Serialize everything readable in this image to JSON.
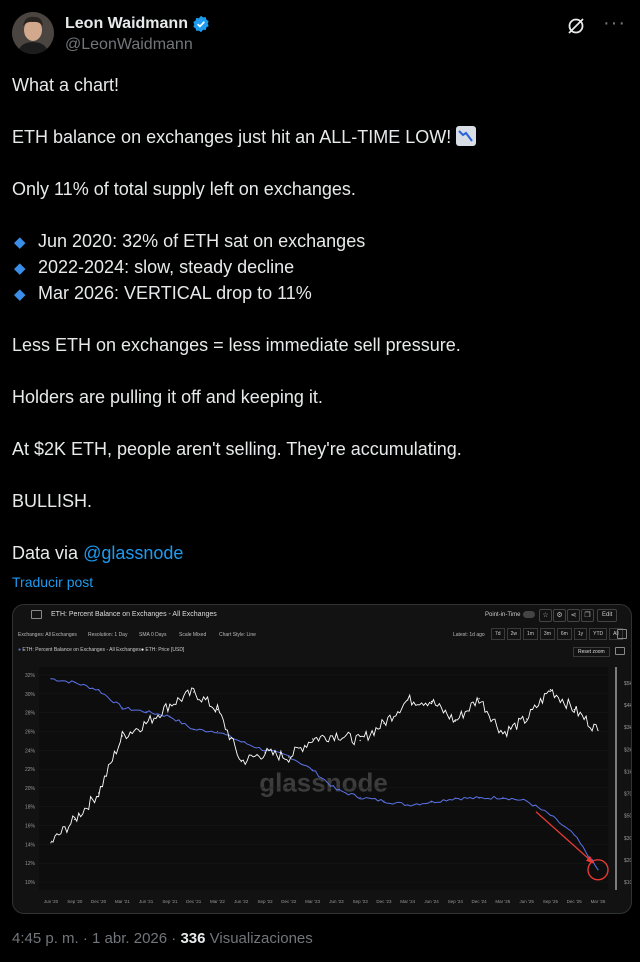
{
  "user": {
    "name": "Leon Waidmann",
    "handle": "@LeonWaidmann"
  },
  "post": {
    "line1": "What a chart!",
    "line2": "ETH balance on exchanges just hit an ALL-TIME LOW!",
    "line3": "Only 11% of total supply left on exchanges.",
    "bullets": [
      "Jun 2020: 32% of ETH sat on exchanges",
      "2022-2024: slow, steady decline",
      "Mar 2026: VERTICAL drop to 11%"
    ],
    "line4": "Less ETH on exchanges = less immediate sell pressure.",
    "line5": "Holders are pulling it off and keeping it.",
    "line6": "At $2K ETH, people aren't selling. They're accumulating.",
    "line7": "BULLISH.",
    "data_via": "Data via",
    "mention": "@glassnode",
    "translate": "Traducir post"
  },
  "footer": {
    "time": "4:45 p. m. · 1 abr. 2026 · ",
    "views_count": "336",
    "views_label": " Visualizaciones"
  },
  "chart_card": {
    "title": "ETH: Percent Balance on Exchanges - All Exchanges",
    "point_in_time": "Point-in-Time",
    "edit": "Edit",
    "filters": [
      "Exchanges: All Exchanges",
      "Resolution: 1 Day",
      "SMA 0 Days",
      "Scale Mixed",
      "Chart Style: Line"
    ],
    "latest": "Latest: 1d ago",
    "ranges": [
      "7d",
      "2w",
      "1m",
      "3m",
      "6m",
      "1y",
      "YTD",
      "All"
    ],
    "reset_zoom": "Reset zoom",
    "watermark": "glassnode",
    "colors": {
      "balance": "#5b73e8",
      "price": "#ffffff",
      "arrow": "#e53935"
    }
  },
  "chart_data": {
    "type": "line",
    "title": "ETH: Percent Balance on Exchanges - All Exchanges",
    "x_ticks": [
      "Jun '20",
      "Sep '20",
      "Dec '20",
      "Mar '21",
      "Jun '21",
      "Sep '21",
      "Dec '21",
      "Mar '22",
      "Jun '22",
      "Sep '22",
      "Dec '22",
      "Mar '23",
      "Jun '23",
      "Sep '23",
      "Dec '23",
      "Mar '24",
      "Jun '24",
      "Sep '24",
      "Dec '24",
      "Mar '25",
      "Jun '25",
      "Sep '25",
      "Dec '25",
      "Mar '26"
    ],
    "y_left_ticks": [
      "32%",
      "30%",
      "28%",
      "26%",
      "24%",
      "22%",
      "20%",
      "18%",
      "16%",
      "14%",
      "12%",
      "10%"
    ],
    "y_left_range": [
      10,
      33
    ],
    "y_right_ticks": [
      "$5k",
      "$4k",
      "$3k",
      "$2k",
      "$1k",
      "$700",
      "$500",
      "$300",
      "$200",
      "$100"
    ],
    "legend": [
      "ETH: Percent Balance on Exchanges - All Exchanges",
      "ETH: Price [USD]"
    ],
    "series": [
      {
        "name": "ETH: Percent Balance on Exchanges - All Exchanges",
        "unit": "%",
        "x": [
          "2020-06",
          "2020-09",
          "2020-12",
          "2021-03",
          "2021-06",
          "2021-09",
          "2021-12",
          "2022-03",
          "2022-06",
          "2022-09",
          "2022-12",
          "2023-03",
          "2023-06",
          "2023-09",
          "2023-12",
          "2024-03",
          "2024-06",
          "2024-09",
          "2024-12",
          "2025-03",
          "2025-06",
          "2025-09",
          "2025-12",
          "2026-03"
        ],
        "values": [
          31.6,
          31.2,
          30.4,
          28.5,
          28.1,
          27.6,
          26.2,
          26.0,
          24.9,
          24.0,
          23.4,
          21.9,
          19.8,
          19.0,
          18.6,
          18.2,
          18.5,
          18.9,
          18.9,
          19.0,
          18.6,
          17.1,
          15.0,
          11.3
        ]
      },
      {
        "name": "ETH: Price [USD]",
        "unit": "USD",
        "x": [
          "2020-06",
          "2020-09",
          "2020-12",
          "2021-03",
          "2021-06",
          "2021-09",
          "2021-12",
          "2022-03",
          "2022-06",
          "2022-09",
          "2022-12",
          "2023-03",
          "2023-06",
          "2023-09",
          "2023-12",
          "2024-03",
          "2024-06",
          "2024-09",
          "2024-12",
          "2025-03",
          "2025-06",
          "2025-09",
          "2025-12",
          "2026-03"
        ],
        "values": [
          230,
          360,
          600,
          1800,
          2300,
          3300,
          4200,
          3000,
          1100,
          1300,
          1200,
          1700,
          1850,
          1650,
          2300,
          3600,
          3500,
          2400,
          3700,
          1900,
          2500,
          4400,
          3000,
          2000
        ]
      }
    ]
  }
}
